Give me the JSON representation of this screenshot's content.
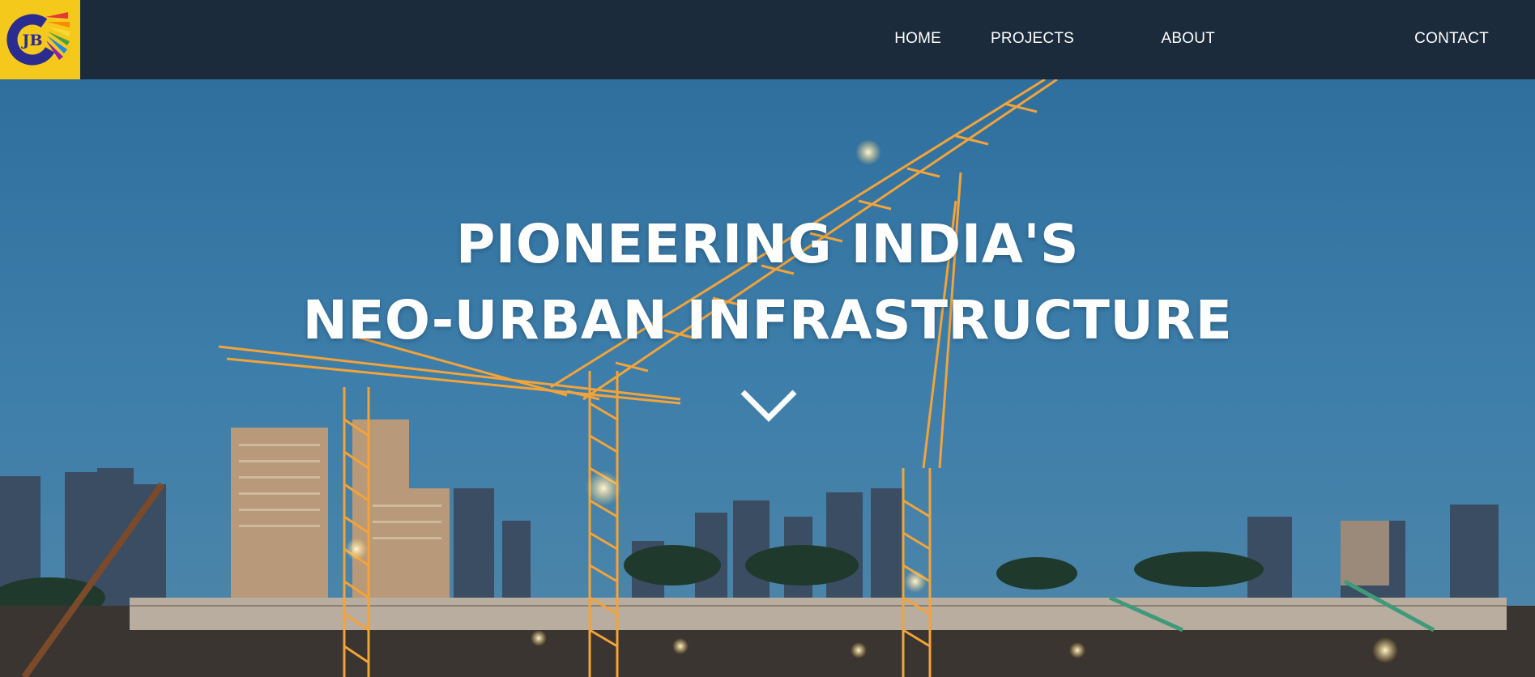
{
  "logo": {
    "text": "JB",
    "icon": "jb-logo-icon"
  },
  "nav": {
    "items": [
      {
        "label": "HOME"
      },
      {
        "label": "PROJECTS"
      },
      {
        "label": "ABOUT"
      },
      {
        "label": "CONTACT"
      }
    ]
  },
  "hero": {
    "headline_line1": "PIONEERING INDIA'S",
    "headline_line2": "NEO-URBAN INFRASTRUCTURE",
    "scroll_icon": "chevron-down-icon"
  },
  "colors": {
    "header_bg": "#1c2b3c",
    "logo_bg": "#f4c91c",
    "logo_ring": "#2a2c8f",
    "text": "#ffffff",
    "crane": "#f2a33a"
  }
}
